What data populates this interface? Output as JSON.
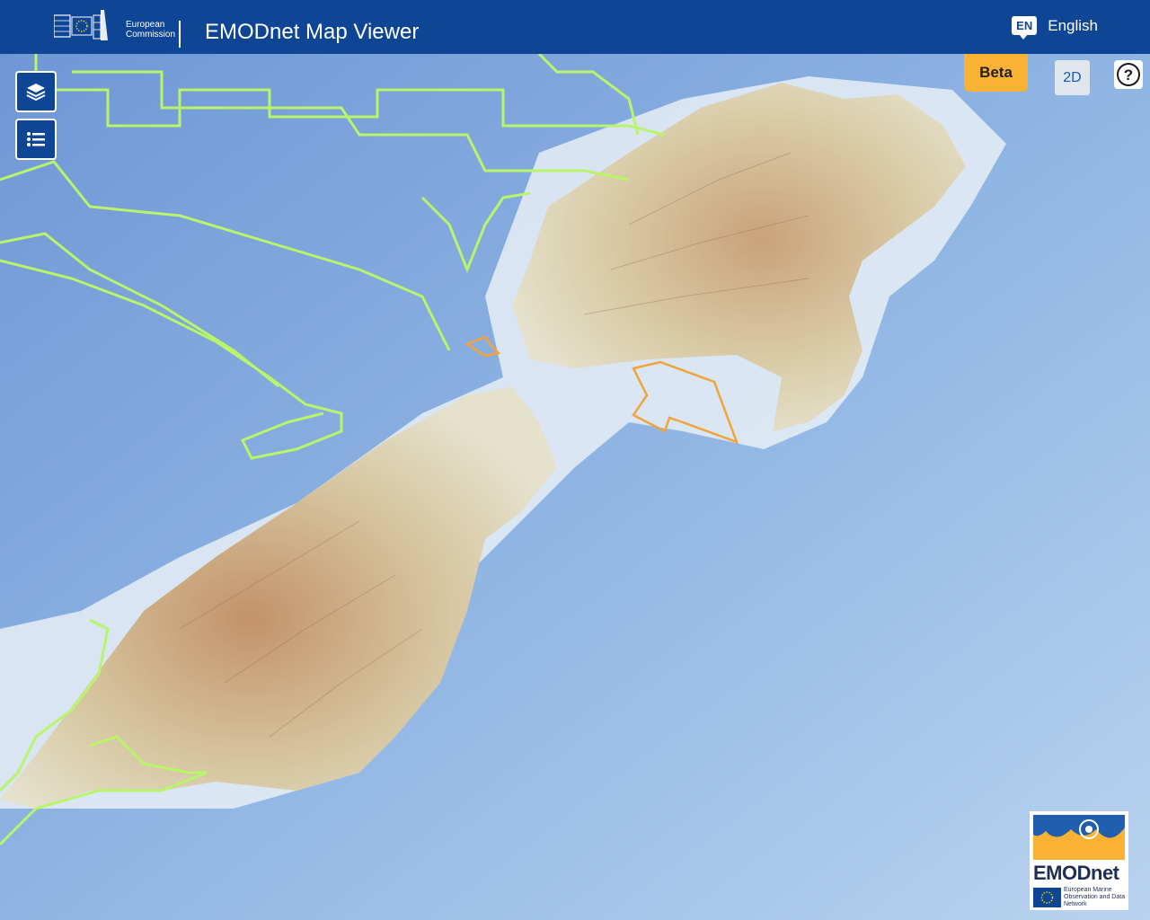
{
  "header": {
    "ec_logo_line1": "European",
    "ec_logo_line2": "Commission",
    "title": "EMODnet Map Viewer",
    "lang_code": "EN",
    "lang_label": "English"
  },
  "toolbar": {
    "layers_icon": "layers-icon",
    "legend_icon": "list-icon",
    "beta_label": "Beta",
    "view_toggle_label": "2D",
    "help_label": "?"
  },
  "footer_logo": {
    "word": "EMODnet",
    "subtitle": "European Marine Observation and Data Network"
  },
  "colors": {
    "brand_blue": "#0e4595",
    "beta_orange": "#f9b233",
    "track_green": "#b8f56a",
    "area_orange": "#f2a33a"
  }
}
